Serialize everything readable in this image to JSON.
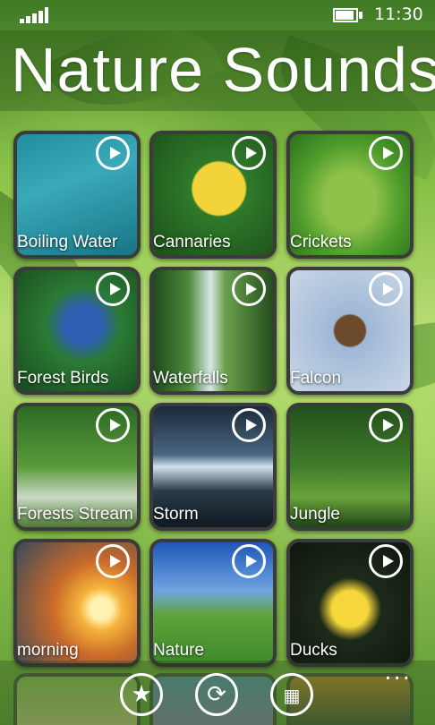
{
  "status_bar": {
    "time": "11:30"
  },
  "header": {
    "title": "Nature Sounds"
  },
  "tiles": [
    {
      "label": "Boiling Water",
      "bg": "linear-gradient(160deg,#1f8fa0,#3aa9b8 40%,#177586)"
    },
    {
      "label": "Cannaries",
      "bg": "radial-gradient(circle at 55% 45%,#f2d43a 0 28%,#2f7a2a 30%,#1c4f18)"
    },
    {
      "label": "Crickets",
      "bg": "radial-gradient(ellipse at 50% 55%,#8fc24a 0 30%,#4f9d2c 60%,#2d6f1c)"
    },
    {
      "label": "Forest Birds",
      "bg": "radial-gradient(circle at 55% 45%,#2c5fb0 0 20%,#2b7a34 40%,#184a1e)"
    },
    {
      "label": "Waterfalls",
      "bg": "linear-gradient(90deg,#1f4a1c,#4d8a3b 30%,#d7e6e8 48%,#6aa14c 60%,#244d1e)"
    },
    {
      "label": "Falcon",
      "bg": "radial-gradient(circle at 50% 50%,#6b4b2c 0 18%,#9fb8d6 20%,#c9d7e6)"
    },
    {
      "label": "Forests Stream",
      "bg": "linear-gradient(180deg,#2c6a24,#5a9a3a 50%,#c9d9c4 75%,#4d7a34)"
    },
    {
      "label": "Storm",
      "bg": "linear-gradient(180deg,#1b2a3a,#4a6680 40%,#cfe2ee 50%,#2a3b48 70%,#0f1a22)"
    },
    {
      "label": "Jungle",
      "bg": "linear-gradient(180deg,#234f1c,#3f7d2a 50%,#6aa33a 75%,#1f4417)"
    },
    {
      "label": "morning",
      "bg": "radial-gradient(circle at 70% 55%,#fff2b0 0 10%,#f5b33a 20%,#c96a2a 45%,#3a4a5a)"
    },
    {
      "label": "Nature",
      "bg": "linear-gradient(180deg,#1e57b8,#6fa4e0 40%,#5fa33a 60%,#3f8a2c)"
    },
    {
      "label": "Ducks",
      "bg": "radial-gradient(circle at 50% 55%,#f6d63a 0 20%,#1d2a1a 35%,#0e160c)"
    }
  ],
  "app_bar": {
    "buttons": [
      "favorite",
      "refresh",
      "store"
    ],
    "more": "..."
  }
}
